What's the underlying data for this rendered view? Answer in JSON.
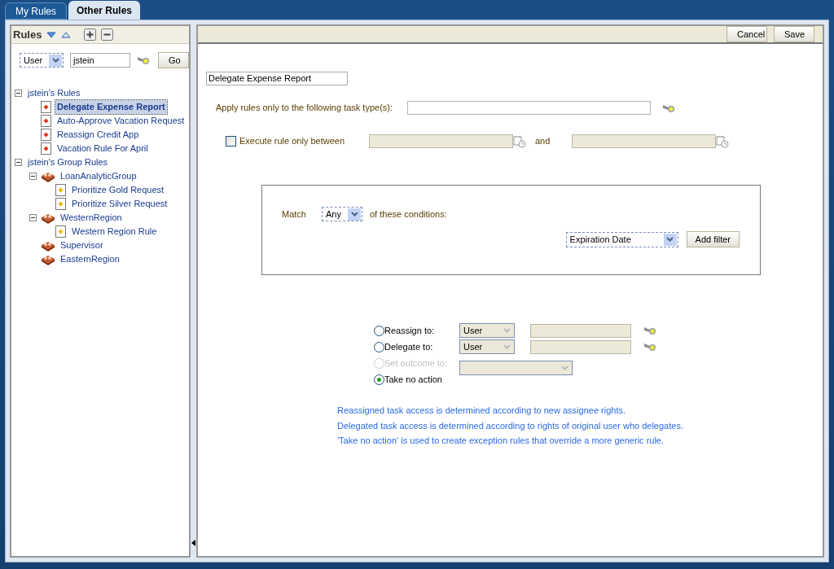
{
  "tabs": [
    {
      "label": "My Rules",
      "selected": false
    },
    {
      "label": "Other Rules",
      "selected": true
    }
  ],
  "rules_panel": {
    "title": "Rules",
    "filter": {
      "type": "User",
      "value": "jstein",
      "go": "Go"
    },
    "tree": [
      {
        "label": "jstein's Rules",
        "expanded": true,
        "children": [
          {
            "label": "Delegate Expense Report",
            "kind": "rule",
            "selected": true
          },
          {
            "label": "Auto-Approve Vacation Request",
            "kind": "rule",
            "selected": false
          },
          {
            "label": "Reassign Credit App",
            "kind": "rule",
            "selected": false
          },
          {
            "label": "Vacation Rule For April",
            "kind": "rule",
            "selected": false
          }
        ]
      },
      {
        "label": "jstein's Group Rules",
        "expanded": true,
        "children": [
          {
            "label": "LoanAnalyticGroup",
            "kind": "group",
            "expanded": true,
            "children": [
              {
                "label": "Prioritize Gold Request",
                "kind": "group_rule",
                "selected": false
              },
              {
                "label": "Prioritize Silver Request",
                "kind": "group_rule",
                "selected": false
              }
            ]
          },
          {
            "label": "WesternRegion",
            "kind": "group",
            "expanded": true,
            "children": [
              {
                "label": "Western Region Rule",
                "kind": "group_rule",
                "selected": false
              }
            ]
          },
          {
            "label": "Supervisor",
            "kind": "group"
          },
          {
            "label": "EasternRegion",
            "kind": "group"
          }
        ]
      }
    ]
  },
  "toolbar": {
    "buttons": [
      "Cancel",
      "Save"
    ]
  },
  "rule": {
    "name": "Delegate Expense Report",
    "task_type_label": "Apply rules only to the following task type(s):",
    "execute": {
      "label": "Execute rule only between",
      "checked": false,
      "and": "and"
    },
    "conditions": {
      "match": "Match",
      "match_value": "Any",
      "suffix": "of these conditions:",
      "filter": "Expiration Date",
      "add": "Add filter"
    },
    "actions": [
      {
        "label": "Reassign to:",
        "selected": false,
        "disabled": false,
        "kind": "assignee",
        "select": "User"
      },
      {
        "label": "Delegate to:",
        "selected": false,
        "disabled": false,
        "kind": "assignee",
        "select": "User"
      },
      {
        "label": "Set outcome to:",
        "selected": false,
        "disabled": true,
        "kind": "outcome"
      },
      {
        "label": "Take no action",
        "selected": true,
        "disabled": false,
        "kind": "none"
      }
    ],
    "notes": [
      "Reassigned task access is determined according to new assignee rights.",
      "Delegated task access is determined according to rights of original user who delegates.",
      "'Take no action' is used to create exception rules that override a more generic rule."
    ]
  }
}
